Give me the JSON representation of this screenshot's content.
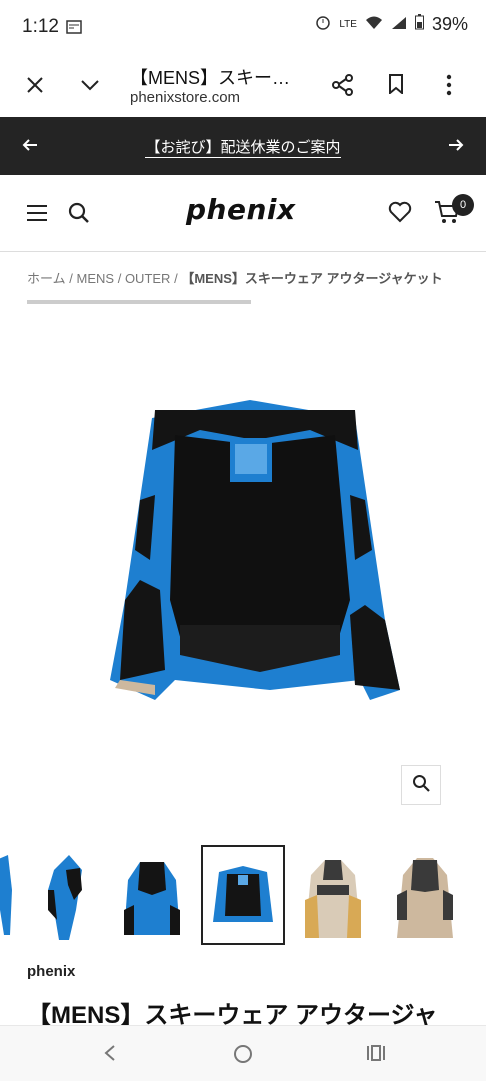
{
  "status_bar": {
    "time": "1:12",
    "network": "LTE",
    "battery": "39%"
  },
  "browser": {
    "title": "【MENS】スキー…",
    "url": "phenixstore.com"
  },
  "banner": {
    "text": "【お詫び】配送休業のご案内"
  },
  "header": {
    "logo": "phenix",
    "cart_count": "0"
  },
  "breadcrumb": {
    "home": "ホーム",
    "sep": "/",
    "mens": "MENS",
    "outer": "OUTER",
    "current": "【MENS】スキーウェア アウタージャケット"
  },
  "product": {
    "brand": "phenix",
    "title": "【MENS】スキーウェア アウタージャ"
  },
  "colors": {
    "banner_bg": "#242424",
    "jacket_blue": "#1e7fd0",
    "jacket_black": "#141414",
    "jacket_beige": "#cdb89e"
  },
  "icons": [
    "close-icon",
    "chevron-down-icon",
    "share-icon",
    "bookmark-icon",
    "more-icon",
    "arrow-left-icon",
    "arrow-right-icon",
    "menu-icon",
    "search-icon",
    "heart-icon",
    "cart-icon",
    "zoom-icon",
    "back-nav-icon",
    "home-nav-icon",
    "recents-nav-icon"
  ]
}
